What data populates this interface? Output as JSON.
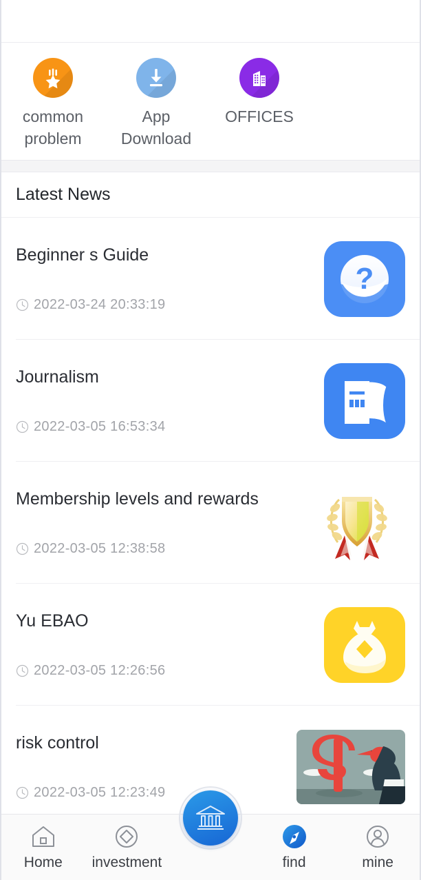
{
  "quick_links": [
    {
      "label": "common problem",
      "icon": "star-badge-icon",
      "color": "#f89415"
    },
    {
      "label": "App Download",
      "icon": "download-icon",
      "color": "#7fb4ea"
    },
    {
      "label": "OFFICES",
      "icon": "office-building-icon",
      "color": "#8a2be6"
    }
  ],
  "section": {
    "title": "Latest News"
  },
  "news": [
    {
      "title": "Beginner s Guide",
      "date": "2022-03-24 20:33:19",
      "icon": "question-mark-icon",
      "thumb_color": "#4b8ef5"
    },
    {
      "title": "Journalism",
      "date": "2022-03-05 16:53:34",
      "icon": "open-book-icon",
      "thumb_color": "#3f86f2"
    },
    {
      "title": "Membership levels and rewards",
      "date": "2022-03-05 12:38:58",
      "icon": "gold-shield-award-icon",
      "thumb_color": "#ffffff"
    },
    {
      "title": "Yu EBAO",
      "date": "2022-03-05 12:26:56",
      "icon": "money-bag-icon",
      "thumb_color": "#ffd328"
    },
    {
      "title": "risk control",
      "date": "2022-03-05 12:23:49",
      "icon": "dollar-dart-icon",
      "thumb_color": "#8fa6a4"
    }
  ],
  "tabbar": {
    "items": [
      {
        "label": "Home",
        "icon": "home-icon"
      },
      {
        "label": "investment",
        "icon": "diamond-circle-icon"
      },
      {
        "label": "",
        "icon": "bank-icon"
      },
      {
        "label": "find",
        "icon": "compass-icon"
      },
      {
        "label": "mine",
        "icon": "user-circle-icon"
      }
    ],
    "center": {
      "icon": "bank-icon",
      "color": "#1b72d8"
    }
  },
  "colors": {
    "page_bg": "#ffffff",
    "divider": "#efeff2",
    "gap_band": "#f4f4f6",
    "title_text": "#2a2d33",
    "date_text": "#a2a4a9",
    "quick_label": "#5b5f66"
  }
}
